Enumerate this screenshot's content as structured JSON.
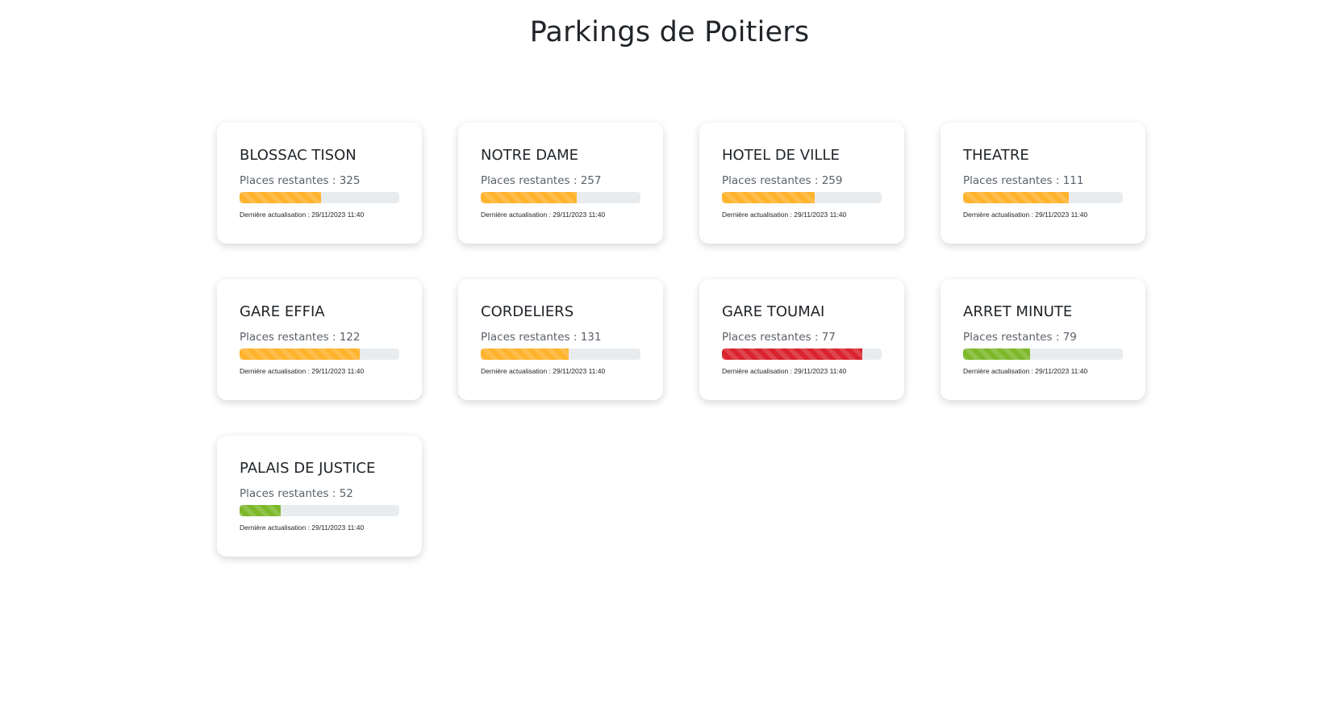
{
  "page": {
    "title": "Parkings de Poitiers"
  },
  "colors": {
    "warning": "#ffb22b",
    "danger": "#d9232e",
    "success": "#7cb82a",
    "track": "#e9ecef"
  },
  "parkings": [
    {
      "name": "BLOSSAC TISON",
      "places_label": "Places restantes : 325",
      "fill_fraction": 0.51,
      "status": "warning",
      "updated": "Dernière actualisation : 29/11/2023 11:40"
    },
    {
      "name": "NOTRE DAME",
      "places_label": "Places restantes : 257",
      "fill_fraction": 0.6,
      "status": "warning",
      "updated": "Dernière actualisation : 29/11/2023 11:40"
    },
    {
      "name": "HOTEL DE VILLE",
      "places_label": "Places restantes : 259",
      "fill_fraction": 0.58,
      "status": "warning",
      "updated": "Dernière actualisation : 29/11/2023 11:40"
    },
    {
      "name": "THEATRE",
      "places_label": "Places restantes : 111",
      "fill_fraction": 0.66,
      "status": "warning",
      "updated": "Dernière actualisation : 29/11/2023 11:40"
    },
    {
      "name": "GARE EFFIA",
      "places_label": "Places restantes : 122",
      "fill_fraction": 0.75,
      "status": "warning",
      "updated": "Dernière actualisation : 29/11/2023 11:40"
    },
    {
      "name": "CORDELIERS",
      "places_label": "Places restantes : 131",
      "fill_fraction": 0.55,
      "status": "warning",
      "updated": "Dernière actualisation : 29/11/2023 11:40"
    },
    {
      "name": "GARE TOUMAI",
      "places_label": "Places restantes : 77",
      "fill_fraction": 0.88,
      "status": "danger",
      "updated": "Dernière actualisation : 29/11/2023 11:40"
    },
    {
      "name": "ARRET MINUTE",
      "places_label": "Places restantes : 79",
      "fill_fraction": 0.42,
      "status": "success",
      "updated": "Dernière actualisation : 29/11/2023 11:40"
    },
    {
      "name": "PALAIS DE JUSTICE",
      "places_label": "Places restantes : 52",
      "fill_fraction": 0.26,
      "status": "success",
      "updated": "Dernière actualisation : 29/11/2023 11:40"
    }
  ]
}
